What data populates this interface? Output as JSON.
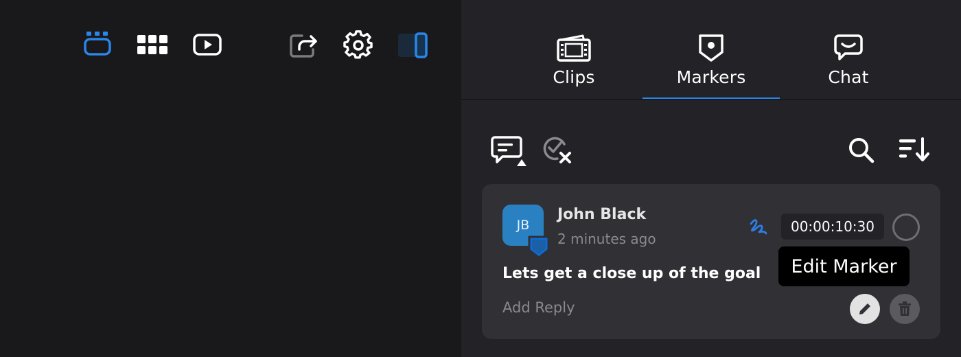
{
  "toolbar": {
    "icons": [
      "layout-stack-icon",
      "grid-icon",
      "play-icon",
      "share-icon",
      "gear-icon",
      "sidebar-toggle-icon"
    ]
  },
  "tabs": [
    {
      "label": "Clips",
      "icon": "clips-icon",
      "active": false
    },
    {
      "label": "Markers",
      "icon": "marker-pin-icon",
      "active": true
    },
    {
      "label": "Chat",
      "icon": "chat-icon",
      "active": false
    }
  ],
  "filters": {
    "icons": [
      "comment-filter-icon",
      "clear-resolved-icon",
      "search-icon",
      "sort-icon"
    ]
  },
  "marker": {
    "avatar_initials": "JB",
    "author": "John Black",
    "time_ago": "2 minutes ago",
    "comment": "Lets get a close up of the goal",
    "add_reply": "Add Reply",
    "timecode": "00:00:10:30",
    "tooltip": "Edit Marker"
  },
  "colors": {
    "accent": "#2a86e8",
    "avatar": "#2a81c2",
    "left_bg": "#19191c",
    "right_bg": "#232327",
    "card_bg": "#303035"
  }
}
